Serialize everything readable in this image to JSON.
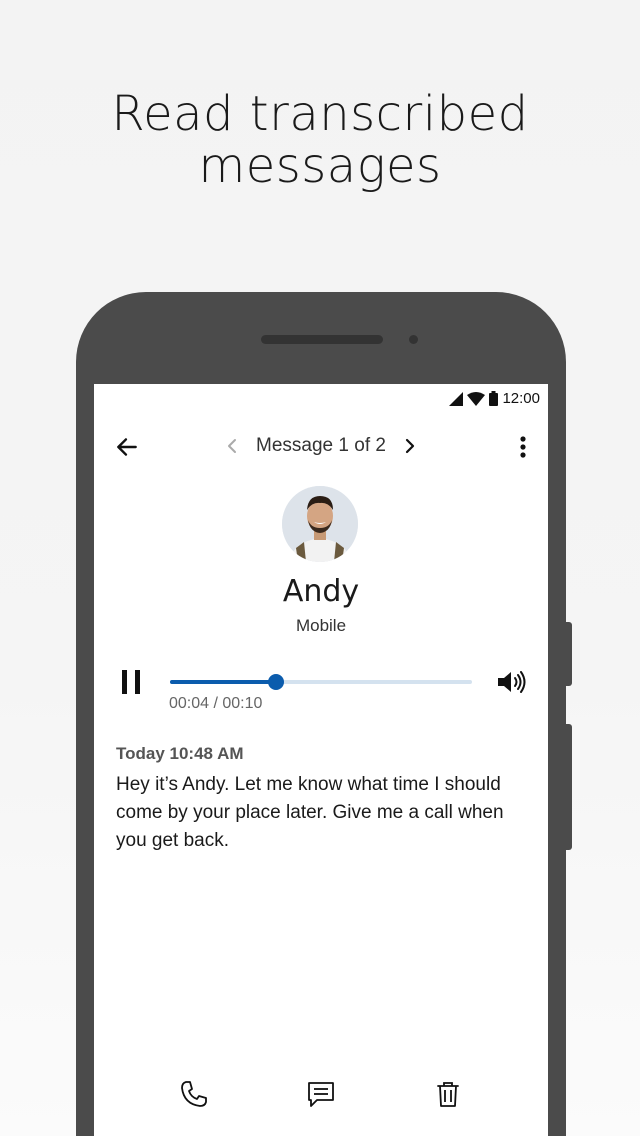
{
  "headline": {
    "line1": "Read transcribed",
    "line2": "messages"
  },
  "status_bar": {
    "time": "12:00",
    "icons": [
      "signal-icon",
      "wifi-icon",
      "battery-icon"
    ]
  },
  "app_bar": {
    "back_icon": "arrow-left-icon",
    "pager_label": "Message 1 of 2",
    "prev_icon": "chevron-left-icon",
    "next_icon": "chevron-right-icon",
    "menu_icon": "more-vertical-icon"
  },
  "contact": {
    "name": "Andy",
    "type": "Mobile"
  },
  "player": {
    "state": "playing",
    "progress": 0.35,
    "time_label": "00:04 / 00:10",
    "accent": "#0b5cad",
    "track_color": "#d4e2ef"
  },
  "message": {
    "date": "Today 10:48 AM",
    "body": "Hey it’s Andy. Let me know what time I should come by your place later. Give me a call when you get back."
  },
  "actions": [
    {
      "name": "call-button",
      "icon": "phone-icon"
    },
    {
      "name": "reply-button",
      "icon": "message-icon"
    },
    {
      "name": "delete-button",
      "icon": "trash-icon"
    }
  ]
}
